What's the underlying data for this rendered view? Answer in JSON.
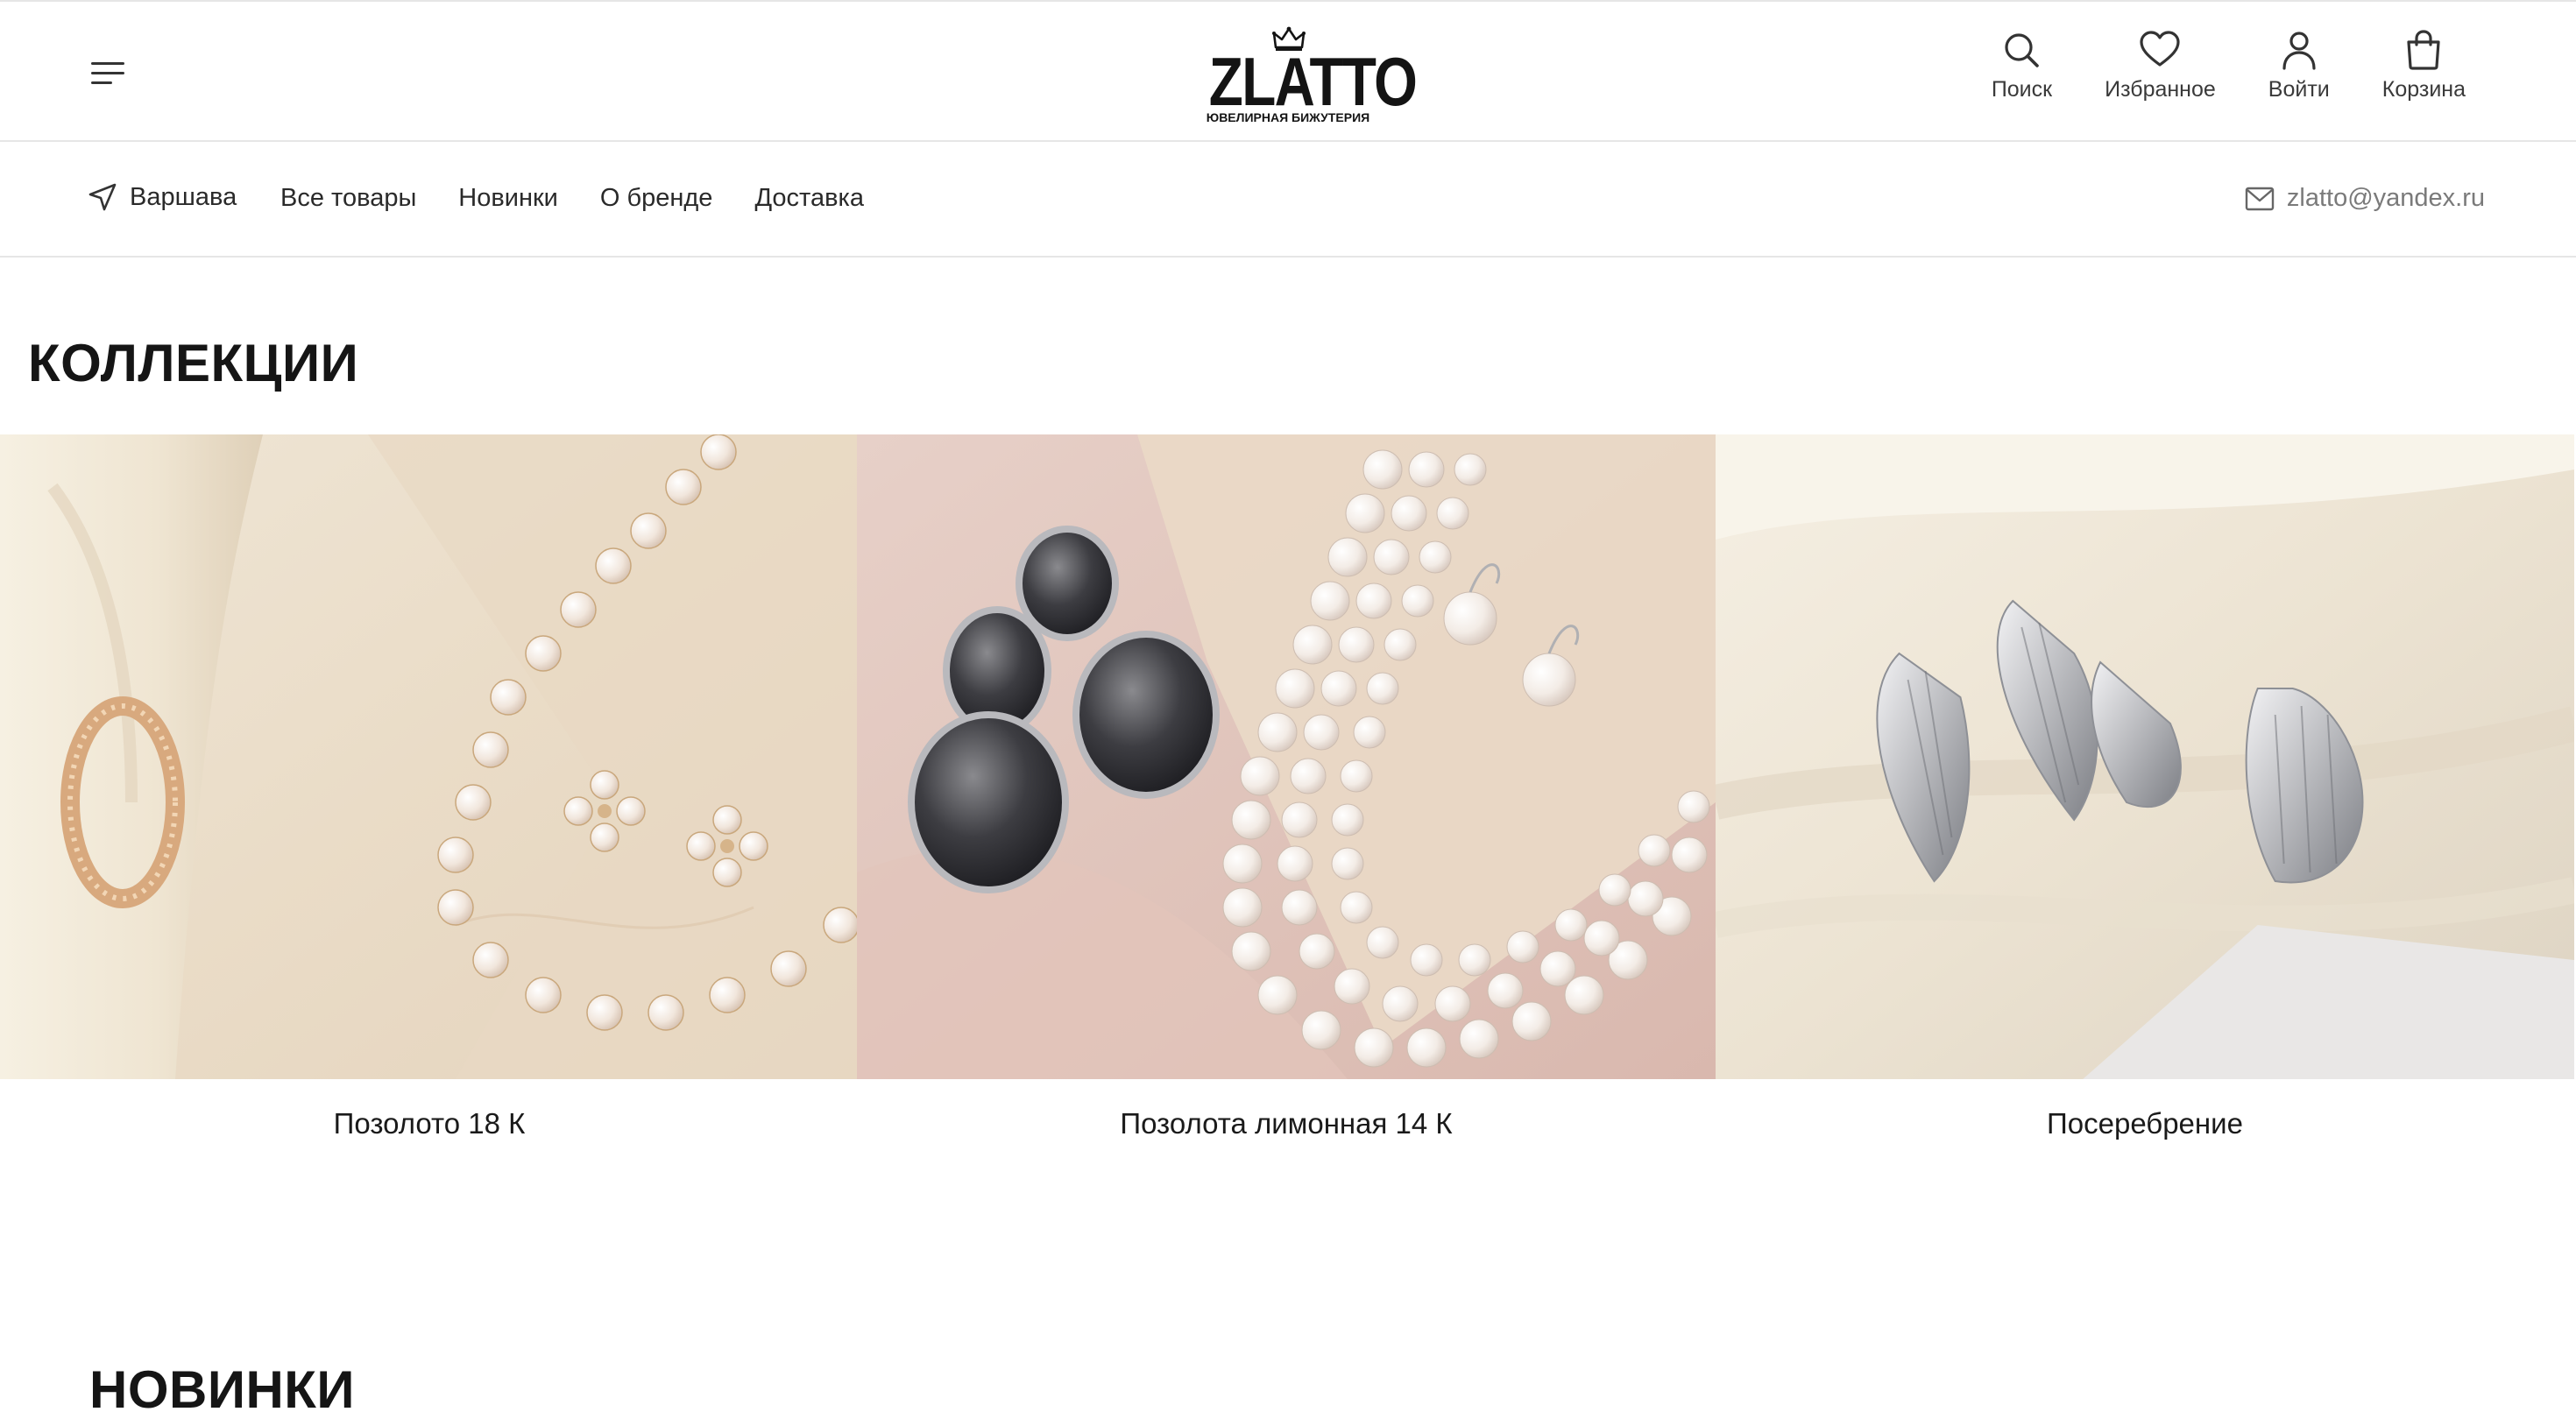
{
  "header": {
    "menu_icon": "menu-icon",
    "logo": {
      "text": "ZLATTO",
      "subtitle": "ЮВЕЛИРНАЯ БИЖУТЕРИЯ"
    },
    "actions": [
      {
        "icon": "search-icon",
        "label": "Поиск"
      },
      {
        "icon": "heart-icon",
        "label": "Избранное"
      },
      {
        "icon": "user-icon",
        "label": "Войти"
      },
      {
        "icon": "bag-icon",
        "label": "Корзина"
      }
    ]
  },
  "subnav": {
    "city": "Варшава",
    "links": [
      "Все товары",
      "Новинки",
      "О бренде",
      "Доставка"
    ],
    "email": "zlatto@yandex.ru"
  },
  "collections": {
    "title": "КОЛЛЕКЦИИ",
    "items": [
      {
        "label": "Позолото 18 К"
      },
      {
        "label": "Позолота лимонная 14 К"
      },
      {
        "label": "Посеребрение"
      }
    ]
  },
  "new_arrivals": {
    "title": "НОВИНКИ"
  },
  "colors": {
    "text": "#1a1a1a",
    "muted": "#7a7a7a",
    "border": "#e6e6e6"
  }
}
